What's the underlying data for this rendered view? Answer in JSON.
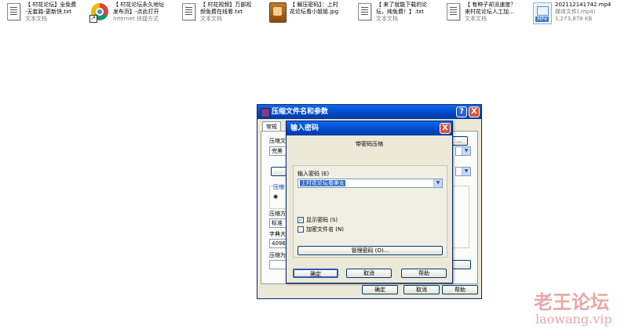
{
  "desktop": {
    "files": [
      {
        "name_line1": "【 村花论坛】全免费",
        "name_line2": "-无套路-更新快.txt",
        "type": "文本文档",
        "icon": "text-document-icon"
      },
      {
        "name_line1": "【 村花论坛永久地址",
        "name_line2": "发布页】-点此打开",
        "type": "Internet 快捷方式",
        "icon": "chrome-shortcut-icon"
      },
      {
        "name_line1": "【 村花视频】万部视",
        "name_line2": "频免费在线看.txt",
        "type": "文本文档",
        "icon": "text-document-icon"
      },
      {
        "name_line1": "【 解压密码】：上村",
        "name_line2": "花论坛看小姐姐.jpg",
        "type": "",
        "icon": "image-file-icon"
      },
      {
        "name_line1": "【 来了就能下载的论",
        "name_line2": "坛，纯免费！】.txt",
        "type": "文本文档",
        "icon": "text-document-icon"
      },
      {
        "name_line1": "【 有种子却没速度？",
        "name_line2": "来村花论坛人工加...",
        "type": "文本文档",
        "icon": "text-document-icon"
      },
      {
        "name_line1": "202112141742.mp4",
        "name_line2": "媒体文件(.mp4)",
        "type": "1,273,878 KB",
        "icon": "mp4-file-icon"
      }
    ],
    "mp4_tag": "MP4"
  },
  "back_window": {
    "title": "压缩文件名和参数",
    "tab": "常规",
    "labels": {
      "archive_name": "压缩文",
      "update_mode": "完美",
      "format": "压缩",
      "method": "压缩方",
      "method_value": "标准",
      "dict": "字典大",
      "dict_value": "4096",
      "split": "压缩为"
    },
    "buttons": {
      "ok": "确定",
      "cancel": "取消",
      "help": "帮助",
      "browse": "..."
    },
    "help_glyph": "?",
    "close_glyph": "X"
  },
  "dialog": {
    "title": "输入密码",
    "subtitle": "带密码压缩",
    "password_label": "输入密码 (E)",
    "password_value": "上村花论坛看美女",
    "show_password": "显示密码 (S)",
    "show_password_checked": true,
    "encrypt_names": "加密文件名 (N)",
    "encrypt_names_checked": false,
    "manage_button": "管理密码 (O)...",
    "ok": "确定",
    "cancel": "取消",
    "help": "帮助",
    "close_glyph": "X"
  },
  "watermark": {
    "line1": "老王论坛",
    "line2": "laowang.vip"
  }
}
